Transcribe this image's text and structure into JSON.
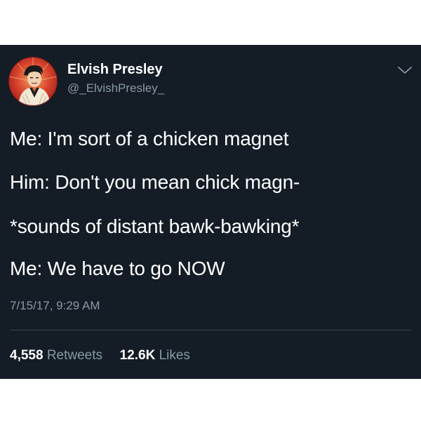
{
  "tweet": {
    "author": {
      "display_name": "Elvish Presley",
      "handle": "@_ElvishPresley_",
      "avatar_icon": "elvis-portrait-avatar"
    },
    "menu_icon": "chevron-down-icon",
    "lines": [
      "Me: I'm sort of a chicken magnet",
      "Him: Don't you mean chick magn-",
      "*sounds of distant bawk-bawking*",
      "Me: We have to go NOW"
    ],
    "timestamp": "7/15/17, 9:29 AM",
    "stats": {
      "retweets_count": "4,558",
      "retweets_label": "Retweets",
      "likes_count": "12.6K",
      "likes_label": "Likes"
    }
  },
  "colors": {
    "card_background": "#141d26",
    "text_primary": "#ffffff",
    "text_secondary": "#8899a6",
    "divider": "#38444d",
    "avatar_red": "#c9302c"
  }
}
